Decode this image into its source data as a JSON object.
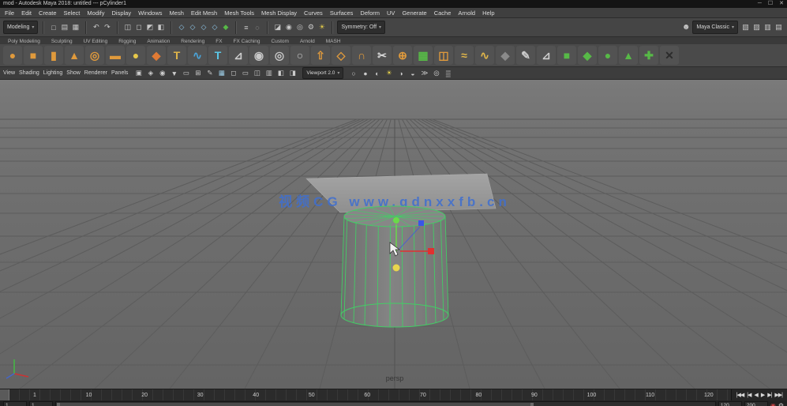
{
  "window": {
    "title": "mod - Autodesk Maya 2018: untitled --- pCylinder1",
    "controls": [
      {
        "name": "minimize-button",
        "glyph": "─"
      },
      {
        "name": "maximize-button",
        "glyph": "☐"
      },
      {
        "name": "close-button",
        "glyph": "✕"
      }
    ]
  },
  "menubar": {
    "items": [
      "File",
      "Edit",
      "Create",
      "Select",
      "Modify",
      "Display",
      "Windows",
      "Mesh",
      "Edit Mesh",
      "Mesh Tools",
      "Mesh Display",
      "Curves",
      "Surfaces",
      "Deform",
      "UV",
      "Generate",
      "Cache",
      "Arnold",
      "Help"
    ]
  },
  "statusline": {
    "menuset": "Modeling",
    "symmetry_label": "Symmetry: Off",
    "workspace": "Maya Classic",
    "file_icons": [
      {
        "name": "new-scene-icon",
        "glyph": "□",
        "color": "#c8c8c8"
      },
      {
        "name": "open-scene-icon",
        "glyph": "▤",
        "color": "#c8c8c8"
      },
      {
        "name": "save-scene-icon",
        "glyph": "▦",
        "color": "#c8c8c8"
      }
    ],
    "undo_icons": [
      {
        "name": "undo-icon",
        "glyph": "↶",
        "color": "#c8c8c8"
      },
      {
        "name": "redo-icon",
        "glyph": "↷",
        "color": "#c8c8c8"
      }
    ],
    "selection_icons": [
      {
        "name": "select-hierarchy-icon",
        "glyph": "◫",
        "color": "#c8c8c8"
      },
      {
        "name": "select-object-icon",
        "glyph": "◻",
        "color": "#c8c8c8"
      },
      {
        "name": "select-component-icon",
        "glyph": "◩",
        "color": "#c8c8c8"
      },
      {
        "name": "select-by-type-icon",
        "glyph": "◧",
        "color": "#c8c8c8"
      }
    ],
    "snap_icons": [
      {
        "name": "snap-to-grid-icon",
        "glyph": "◇",
        "color": "#8ec6e8"
      },
      {
        "name": "snap-to-curve-icon",
        "glyph": "◇",
        "color": "#8ec6e8"
      },
      {
        "name": "snap-to-point-icon",
        "glyph": "◇",
        "color": "#8ec6e8"
      },
      {
        "name": "snap-to-plane-icon",
        "glyph": "◇",
        "color": "#8ec6e8"
      },
      {
        "name": "make-live-icon",
        "glyph": "◆",
        "color": "#57b947"
      }
    ],
    "history_icons": [
      {
        "name": "construction-history-icon",
        "glyph": "≡",
        "color": "#c8c8c8"
      },
      {
        "name": "cache-playback-icon",
        "glyph": "◌",
        "color": "#c8c8c8"
      }
    ],
    "render_icons": [
      {
        "name": "open-render-view-icon",
        "glyph": "◪",
        "color": "#c8c8c8"
      },
      {
        "name": "render-current-frame-icon",
        "glyph": "◉",
        "color": "#c8c8c8"
      },
      {
        "name": "ipr-render-icon",
        "glyph": "◎",
        "color": "#c8c8c8"
      },
      {
        "name": "render-settings-icon",
        "glyph": "⚙",
        "color": "#c8c8c8"
      },
      {
        "name": "light-editor-icon",
        "glyph": "☀",
        "color": "#e0c84a"
      }
    ],
    "editor_icons": [
      {
        "name": "modeling-toolkit-icon",
        "glyph": "▧",
        "color": "#c8c8c8"
      },
      {
        "name": "attribute-editor-icon",
        "glyph": "▨",
        "color": "#c8c8c8"
      },
      {
        "name": "tool-settings-icon",
        "glyph": "▥",
        "color": "#c8c8c8"
      },
      {
        "name": "channel-box-icon",
        "glyph": "▤",
        "color": "#c8c8c8"
      }
    ]
  },
  "shelf": {
    "tabs": [
      "Poly Modeling",
      "Sculpting",
      "UV Editing",
      "Rigging",
      "Animation",
      "Rendering",
      "FX",
      "FX Caching",
      "Custom",
      "Arnold",
      "MASH"
    ],
    "icons": [
      {
        "name": "poly-sphere-icon",
        "glyph": "●",
        "color": "#e09a3c"
      },
      {
        "name": "poly-cube-icon",
        "glyph": "■",
        "color": "#e09a3c"
      },
      {
        "name": "poly-cylinder-icon",
        "glyph": "▮",
        "color": "#e09a3c"
      },
      {
        "name": "poly-cone-icon",
        "glyph": "▲",
        "color": "#e09a3c"
      },
      {
        "name": "poly-torus-icon",
        "glyph": "◎",
        "color": "#e09a3c"
      },
      {
        "name": "poly-plane-icon",
        "glyph": "▬",
        "color": "#e09a3c"
      },
      {
        "name": "poly-disc-icon",
        "glyph": "●",
        "color": "#e6c84a"
      },
      {
        "name": "platonic-solid-icon",
        "glyph": "◆",
        "color": "#e07a34"
      },
      {
        "name": "poly-text-icon",
        "glyph": "T",
        "color": "#e0b54a"
      },
      {
        "name": "sweep-mesh-icon",
        "glyph": "∿",
        "color": "#4aa3d8"
      },
      {
        "name": "type-tool-icon",
        "glyph": "T",
        "color": "#5bc8e8"
      },
      {
        "name": "measure-tool-icon",
        "glyph": "⊿",
        "color": "#cccccc"
      },
      {
        "name": "boolean-union-icon",
        "glyph": "◉",
        "color": "#c8c8c8"
      },
      {
        "name": "combine-icon",
        "glyph": "◎",
        "color": "#c8c8c8"
      },
      {
        "name": "separate-icon",
        "glyph": "○",
        "color": "#c8c8c8"
      },
      {
        "name": "extrude-icon",
        "glyph": "⇧",
        "color": "#e09a3c"
      },
      {
        "name": "bevel-icon",
        "glyph": "◇",
        "color": "#e09a3c"
      },
      {
        "name": "bridge-icon",
        "glyph": "∩",
        "color": "#e09a3c"
      },
      {
        "name": "multi-cut-icon",
        "glyph": "✂",
        "color": "#d8d8d8"
      },
      {
        "name": "target-weld-icon",
        "glyph": "⊕",
        "color": "#e09a3c"
      },
      {
        "name": "quad-draw-icon",
        "glyph": "▦",
        "color": "#57b947"
      },
      {
        "name": "mirror-icon",
        "glyph": "◫",
        "color": "#e09a3c"
      },
      {
        "name": "smooth-icon",
        "glyph": "≈",
        "color": "#e0b54a"
      },
      {
        "name": "crease-tool-icon",
        "glyph": "∿",
        "color": "#e0b54a"
      },
      {
        "name": "lock-length-icon",
        "glyph": "◆",
        "color": "#8a8a8a"
      },
      {
        "name": "curve-pencil-icon",
        "glyph": "✎",
        "color": "#cccccc"
      },
      {
        "name": "ep-curve-icon",
        "glyph": "⊿",
        "color": "#cccccc"
      },
      {
        "name": "mash-network-icon",
        "glyph": "■",
        "color": "#57b947"
      },
      {
        "name": "mash-repro-icon",
        "glyph": "◆",
        "color": "#57b947"
      },
      {
        "name": "mash-dynamics-icon",
        "glyph": "●",
        "color": "#57b947"
      },
      {
        "name": "mash-flight-icon",
        "glyph": "▲",
        "color": "#57b947"
      },
      {
        "name": "bifrost-graph-icon",
        "glyph": "✚",
        "color": "#57b947"
      },
      {
        "name": "delete-history-icon",
        "glyph": "✕",
        "color": "#2b2b2b"
      }
    ]
  },
  "panel_toolbar": {
    "menus": [
      "View",
      "Shading",
      "Lighting",
      "Show",
      "Renderer",
      "Panels"
    ],
    "renderer": "Viewport 2.0",
    "icons_left": [
      {
        "name": "select-camera-icon",
        "glyph": "▣",
        "color": "#cccccc"
      },
      {
        "name": "lock-camera-icon",
        "glyph": "◈",
        "color": "#cccccc"
      },
      {
        "name": "camera-attributes-icon",
        "glyph": "◉",
        "color": "#cccccc"
      },
      {
        "name": "bookmark-icon",
        "glyph": "▼",
        "color": "#cccccc"
      },
      {
        "name": "image-plane-icon",
        "glyph": "▭",
        "color": "#cccccc"
      },
      {
        "name": "two-d-pan-zoom-icon",
        "glyph": "⊞",
        "color": "#cccccc"
      },
      {
        "name": "grease-pencil-icon",
        "glyph": "✎",
        "color": "#cccccc"
      },
      {
        "name": "grid-toggle-icon",
        "glyph": "▦",
        "color": "#9ecfe8"
      },
      {
        "name": "film-gate-icon",
        "glyph": "◻",
        "color": "#cccccc"
      },
      {
        "name": "resolution-gate-icon",
        "glyph": "▭",
        "color": "#cccccc"
      },
      {
        "name": "gate-mask-icon",
        "glyph": "◫",
        "color": "#cccccc"
      },
      {
        "name": "field-chart-icon",
        "glyph": "▥",
        "color": "#cccccc"
      },
      {
        "name": "safe-action-icon",
        "glyph": "◧",
        "color": "#cccccc"
      },
      {
        "name": "safe-title-icon",
        "glyph": "◨",
        "color": "#cccccc"
      }
    ],
    "icons_right": [
      {
        "name": "wireframe-mode-icon",
        "glyph": "○",
        "color": "#cccccc"
      },
      {
        "name": "shaded-mode-icon",
        "glyph": "●",
        "color": "#cccccc"
      },
      {
        "name": "textured-mode-icon",
        "glyph": "◐",
        "color": "#cccccc"
      },
      {
        "name": "lights-icon",
        "glyph": "☀",
        "color": "#e8d44d"
      },
      {
        "name": "shadows-icon",
        "glyph": "◑",
        "color": "#cccccc"
      },
      {
        "name": "ao-icon",
        "glyph": "◒",
        "color": "#cccccc"
      },
      {
        "name": "motion-blur-icon",
        "glyph": "≫",
        "color": "#cccccc"
      },
      {
        "name": "isolate-select-icon",
        "glyph": "◎",
        "color": "#cccccc"
      },
      {
        "name": "xray-icon",
        "glyph": "▒",
        "color": "#cccccc"
      }
    ]
  },
  "viewport": {
    "watermark": "视频CG www.qdnxxfb.cn",
    "camera_label": "persp",
    "selected_object": "pCylinder1",
    "colors": {
      "background": "#6f6f6f",
      "grid_line": "#5c5c5c",
      "selection_green": "#44cc66",
      "watermark_blue": "#3f6fd0",
      "manip_x": "#e03030",
      "manip_y": "#6ad94a",
      "manip_z": "#3a55e8",
      "manip_center": "#e8d44d"
    }
  },
  "timeline": {
    "frames": [
      "1",
      "10",
      "20",
      "30",
      "40",
      "50",
      "60",
      "70",
      "80",
      "90",
      "100",
      "110",
      "120"
    ],
    "transport": [
      {
        "name": "go-to-start-button",
        "glyph": "|◀◀"
      },
      {
        "name": "step-back-frame-button",
        "glyph": "|◀"
      },
      {
        "name": "play-backward-button",
        "glyph": "◀"
      },
      {
        "name": "play-forward-button",
        "glyph": "▶"
      },
      {
        "name": "step-forward-frame-button",
        "glyph": "▶|"
      },
      {
        "name": "go-to-end-button",
        "glyph": "▶▶|"
      }
    ]
  },
  "range_slider": {
    "anim_start": "1",
    "playback_start": "1",
    "playback_end": "120",
    "anim_end": "200"
  }
}
